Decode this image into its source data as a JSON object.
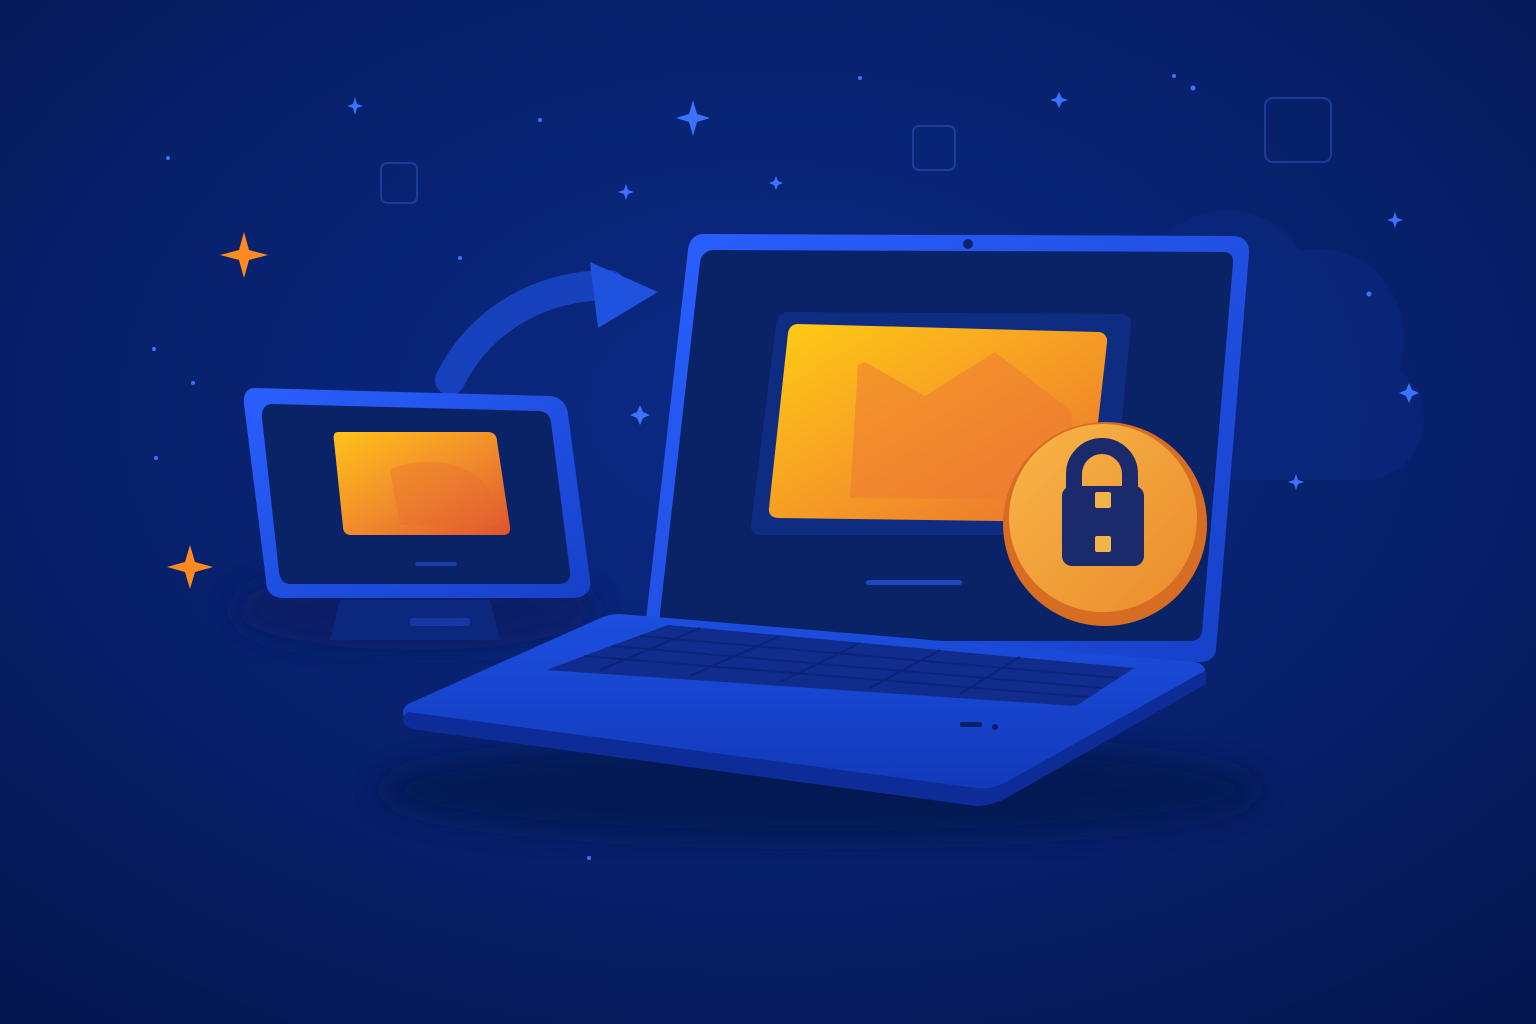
{
  "illustration": {
    "subject": "transfer-to-secure-laptop",
    "icons": [
      "monitor-icon",
      "arrow-icon",
      "laptop-icon",
      "image-icon",
      "lock-icon",
      "sparkle-icon",
      "star-icon",
      "frame-icon",
      "cloud-icon"
    ]
  },
  "palette": {
    "background_top": "#0a2274",
    "background_bottom": "#041650",
    "device_blue": "#1745d4",
    "device_blue_light": "#2a5bff",
    "screen_dark": "#0a2266",
    "accent_yellow": "#ffc21a",
    "accent_orange": "#f08a2a",
    "accent_red": "#e0552e",
    "lock_badge": "#f3a33a",
    "lock_dark": "#1b2a6a",
    "sparkle_orange": "#ff8a1f",
    "star_blue": "#3a73ff"
  }
}
